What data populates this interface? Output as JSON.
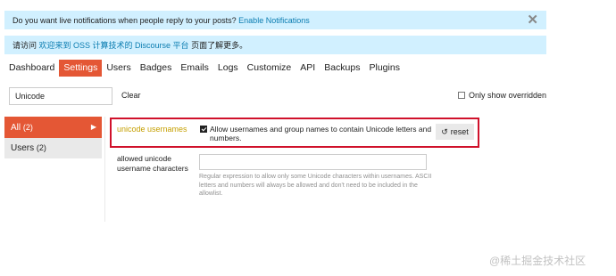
{
  "notices": {
    "notifications_text": "Do you want live notifications when people reply to your posts?",
    "notifications_link": "Enable Notifications",
    "close_glyph": "✕",
    "visit_prefix": "请访问",
    "visit_link": "欢迎来到 OSS 计算技术的 Discourse 平台",
    "visit_suffix": "页面了解更多。"
  },
  "nav": {
    "tabs": [
      {
        "label": "Dashboard",
        "active": false
      },
      {
        "label": "Settings",
        "active": true
      },
      {
        "label": "Users",
        "active": false
      },
      {
        "label": "Badges",
        "active": false
      },
      {
        "label": "Emails",
        "active": false
      },
      {
        "label": "Logs",
        "active": false
      },
      {
        "label": "Customize",
        "active": false
      },
      {
        "label": "API",
        "active": false
      },
      {
        "label": "Backups",
        "active": false
      },
      {
        "label": "Plugins",
        "active": false
      }
    ]
  },
  "filter": {
    "value": "Unicode",
    "clear_label": "Clear",
    "only_overridden_label": "Only show overridden",
    "only_overridden_checked": false
  },
  "sidebar": {
    "items": [
      {
        "label": "All",
        "count": "(2)",
        "active": true
      },
      {
        "label": "Users",
        "count": "(2)",
        "active": false
      }
    ]
  },
  "settings": {
    "unicode_usernames": {
      "label": "unicode usernames",
      "checked": true,
      "description": "Allow usernames and group names to contain Unicode letters and numbers.",
      "reset_label": "reset"
    },
    "allowed_chars": {
      "label": "allowed unicode username characters",
      "value": "",
      "description": "Regular expression to allow only some Unicode characters within usernames. ASCII letters and numbers will always be allowed and don't need to be included in the allowlist."
    }
  },
  "watermark": "@稀土掘金技术社区",
  "colors": {
    "accent": "#e45735",
    "notice_bg": "#d1f0ff",
    "link": "#0a7cb0",
    "highlight_border": "#d0112b",
    "overridden_label": "#c59f00"
  },
  "icons": {
    "close": "close-icon",
    "arrow": "chevron-right-icon",
    "reset": "undo-icon",
    "checkbox": "checkbox-icon"
  }
}
